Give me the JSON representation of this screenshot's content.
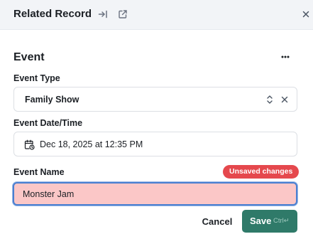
{
  "header": {
    "title": "Related Record",
    "icons": [
      "collapse-to-side-icon",
      "open-external-icon",
      "close-icon"
    ]
  },
  "section": {
    "title": "Event",
    "menu_icon": "more-horizontal-icon"
  },
  "fields": {
    "event_type": {
      "label": "Event Type",
      "value": "Family Show",
      "icons": [
        "chevron-up-down-icon",
        "clear-icon"
      ]
    },
    "event_datetime": {
      "label": "Event Date/Time",
      "value": "Dec 18, 2025 at 12:35 PM",
      "icon": "calendar-clock-icon"
    },
    "event_name": {
      "label": "Event Name",
      "value": "Monster Jam",
      "badge": "Unsaved changes"
    }
  },
  "actions": {
    "cancel_label": "Cancel",
    "save_label": "Save",
    "save_shortcut": "Ctrl↵"
  },
  "colors": {
    "header_bg": "#f2f4f7",
    "badge_bg": "#e5484d",
    "input_unsaved_bg": "#fbc7c7",
    "focus_border": "#4a7fd0",
    "save_bg": "#2f7a69"
  }
}
